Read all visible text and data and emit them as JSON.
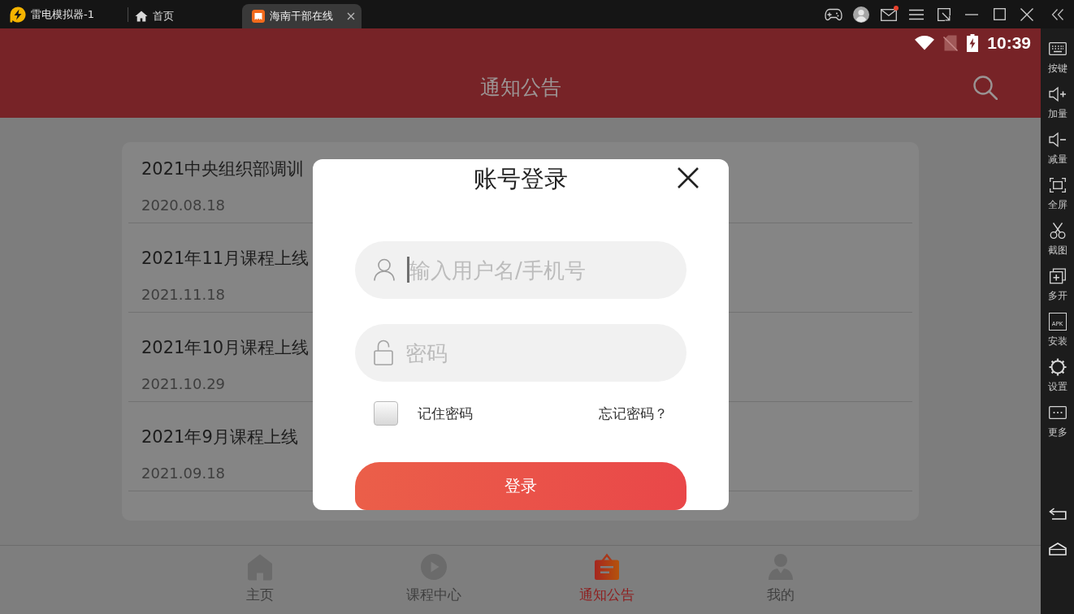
{
  "emulator": {
    "app_name": "雷电模拟器-1",
    "tabs": [
      {
        "kind": "home",
        "label": "首页",
        "selected": false
      },
      {
        "kind": "app",
        "label": "海南干部在线",
        "selected": true
      }
    ],
    "mail_unread": true
  },
  "sidebar": {
    "items": [
      {
        "kind": "keyboard",
        "label": "按键"
      },
      {
        "kind": "volume_up",
        "label": "加量"
      },
      {
        "kind": "volume_down",
        "label": "减量"
      },
      {
        "kind": "fullscreen",
        "label": "全屏"
      },
      {
        "kind": "screenshot",
        "label": "截图"
      },
      {
        "kind": "multi",
        "label": "多开"
      },
      {
        "kind": "apk",
        "label": "安装",
        "icon_text": "APK"
      },
      {
        "kind": "settings",
        "label": "设置"
      },
      {
        "kind": "more",
        "label": "更多"
      }
    ]
  },
  "status_bar": {
    "time": "10:39"
  },
  "app_bar": {
    "title": "通知公告"
  },
  "notices": [
    {
      "title": "2021中央组织部调训",
      "date": "2020.08.18"
    },
    {
      "title": "2021年11月课程上线",
      "date": "2021.11.18"
    },
    {
      "title": "2021年10月课程上线",
      "date": "2021.10.29"
    },
    {
      "title": "2021年9月课程上线",
      "date": "2021.09.18"
    }
  ],
  "login_dialog": {
    "title": "账号登录",
    "username": {
      "placeholder": "输入用户名/手机号",
      "focused": true
    },
    "password": {
      "placeholder": "密码"
    },
    "remember": {
      "label": "记住密码",
      "checked": false
    },
    "forgot_link": "忘记密码？",
    "submit": "登录"
  },
  "bottom_nav": [
    {
      "kind": "home",
      "label": "主页",
      "selected": false
    },
    {
      "kind": "play",
      "label": "课程中心",
      "selected": false
    },
    {
      "kind": "notice",
      "label": "通知公告",
      "selected": true
    },
    {
      "kind": "profile",
      "label": "我的",
      "selected": false
    }
  ]
}
